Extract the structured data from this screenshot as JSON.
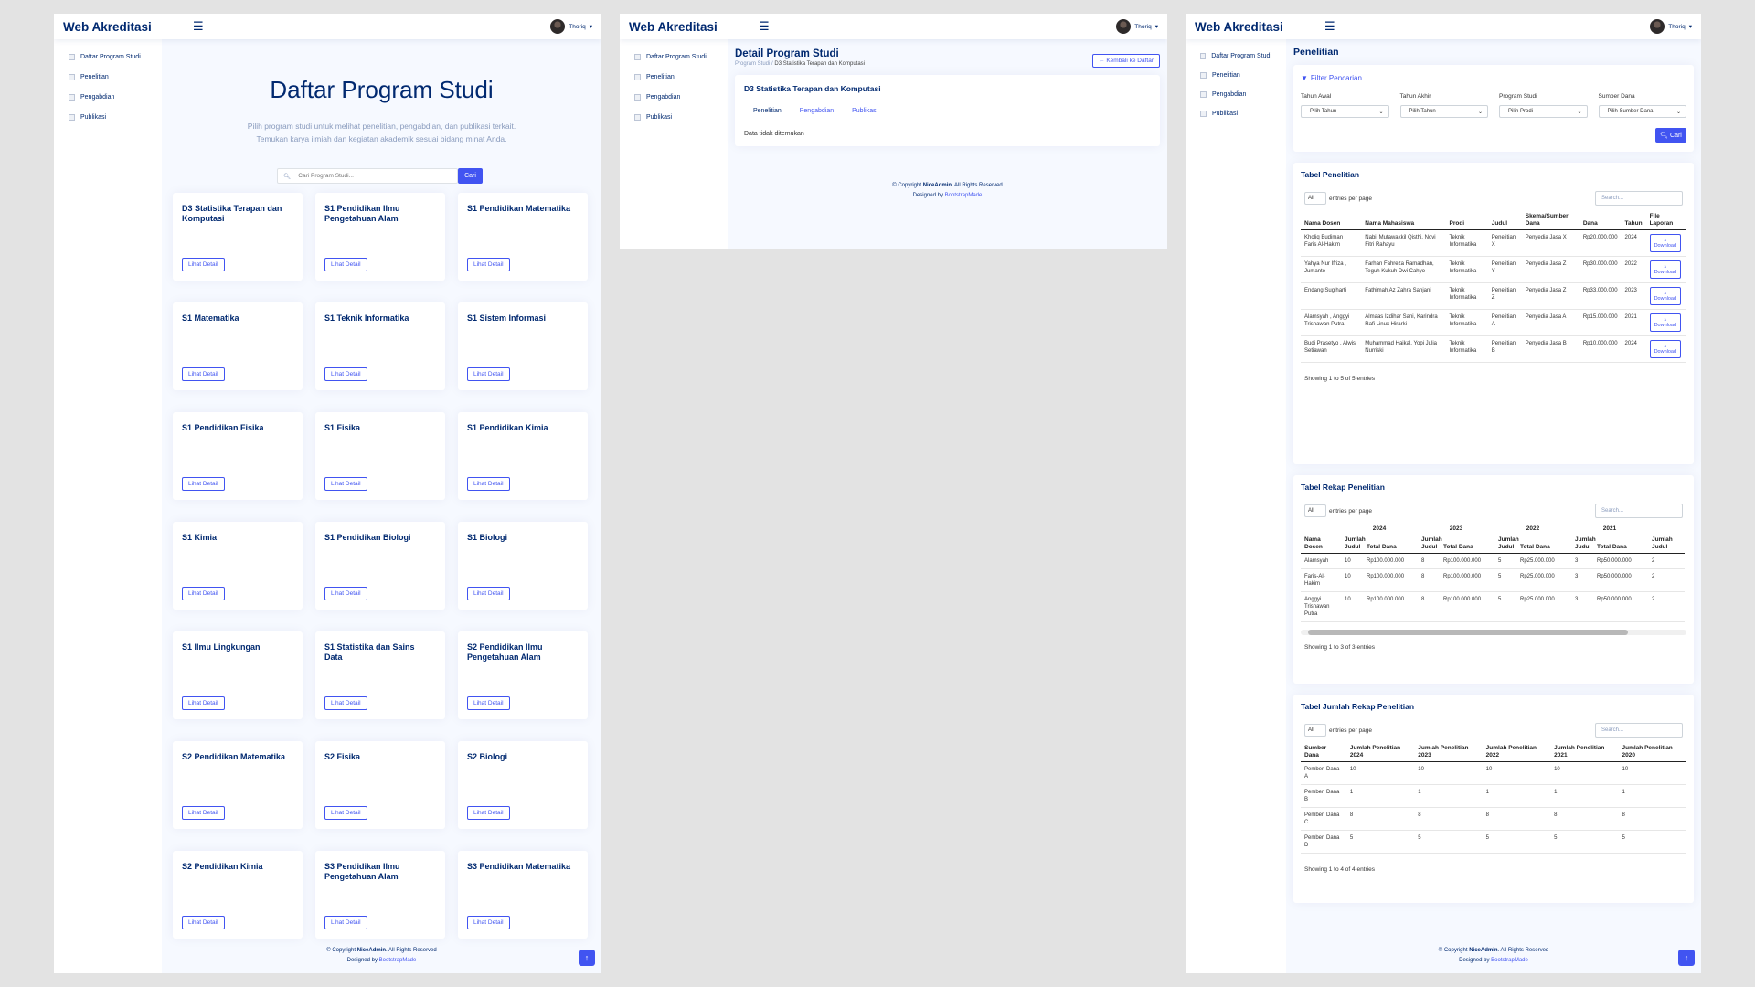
{
  "app": {
    "logo": "Web Akreditasi",
    "user_name": "Thoriq"
  },
  "sidebar": {
    "items": [
      "Daftar Program Studi",
      "Penelitian",
      "Pengabdian",
      "Publikasi"
    ]
  },
  "footer": {
    "copyright_prefix": "© Copyright",
    "brand": "NiceAdmin",
    "rights": ". All Rights Reserved",
    "designed_by": "Designed by",
    "designer": "BootstrapMade"
  },
  "panel1": {
    "title": "Daftar Program Studi",
    "subtitle_line1": "Pilih program studi untuk melihat penelitian, pengabdian, dan publikasi terkait.",
    "subtitle_line2": "Temukan karya ilmiah dan kegiatan akademik sesuai bidang minat Anda.",
    "search_placeholder": "Cari Program Studi...",
    "search_button": "Cari",
    "detail_button": "Lihat Detail",
    "programs": [
      "D3 Statistika Terapan dan Komputasi",
      "S1 Pendidikan Ilmu Pengetahuan Alam",
      "S1 Pendidikan Matematika",
      "S1 Matematika",
      "S1 Teknik Informatika",
      "S1 Sistem Informasi",
      "S1 Pendidikan Fisika",
      "S1 Fisika",
      "S1 Pendidikan Kimia",
      "S1 Kimia",
      "S1 Pendidikan Biologi",
      "S1 Biologi",
      "S1 Ilmu Lingkungan",
      "S1 Statistika dan Sains Data",
      "S2 Pendidikan Ilmu Pengetahuan Alam",
      "S2 Pendidikan Matematika",
      "S2 Fisika",
      "S2 Biologi",
      "S2 Pendidikan Kimia",
      "S3 Pendidikan Ilmu Pengetahuan Alam",
      "S3 Pendidikan Matematika"
    ]
  },
  "panel2": {
    "title": "Detail Program Studi",
    "breadcrumb_root": "Program Studi",
    "breadcrumb_current": "D3 Statistika Terapan dan Komputasi",
    "back_button": "Kembali ke Daftar",
    "program_name": "D3 Statistika Terapan dan Komputasi",
    "tabs": [
      "Penelitian",
      "Pengabdian",
      "Publikasi"
    ],
    "empty_text": "Data tidak ditemukan"
  },
  "panel3": {
    "page_title": "Penelitian",
    "filter_title": "Filter Pencarian",
    "filters": [
      {
        "label": "Tahun Awal",
        "value": "--Pilih Tahun--"
      },
      {
        "label": "Tahun Akhir",
        "value": "--Pilih Tahun--"
      },
      {
        "label": "Program Studi",
        "value": "--Pilih Prodi--"
      },
      {
        "label": "Sumber Dana",
        "value": "--Pilih Sumber Dana--"
      }
    ],
    "search_button": "Cari",
    "entries_value": "All",
    "entries_label": "entries per page",
    "search_placeholder": "Search...",
    "download_label": "Download",
    "table1": {
      "title": "Tabel Penelitian",
      "headers": [
        "Nama Dosen",
        "Nama Mahasiswa",
        "Prodi",
        "Judul",
        "Skema/Sumber Dana",
        "Dana",
        "Tahun",
        "File Laporan"
      ],
      "rows": [
        [
          "Kholiq Budiman , Faris Al-Hakim",
          "Nabil Mutawakkil Qisthi, Novi Fitri Rahayu",
          "Teknik Informatika",
          "Penelitian X",
          "Penyedia Jasa X",
          "Rp20.000.000",
          "2024"
        ],
        [
          "Yahya Nur Ifriza , Jumanto",
          "Farhan Fahreza Ramadhan, Teguh Kukuh Dwi Cahyo",
          "Teknik Informatika",
          "Penelitian Y",
          "Penyedia Jasa Z",
          "Rp30.000.000",
          "2022"
        ],
        [
          "Endang Sugiharti",
          "Fathimah Az Zahra Sanjani",
          "Teknik Informatika",
          "Penelitian Z",
          "Penyedia Jasa Z",
          "Rp33.000.000",
          "2023"
        ],
        [
          "Alamsyah , Anggyi Trisnawan Putra",
          "Almaas Izdihar Sani, Karindra Rafi Linux Hirarki",
          "Teknik Informatika",
          "Penelitian A",
          "Penyedia Jasa A",
          "Rp15.000.000",
          "2021"
        ],
        [
          "Budi Prasetyo , Alwis Setiawan",
          "Muhammad Haikal, Yopi Julia Nurriski",
          "Teknik Informatika",
          "Penelitian B",
          "Penyedia Jasa B",
          "Rp10.000.000",
          "2024"
        ]
      ],
      "showing": "Showing 1 to 5 of 5 entries"
    },
    "table2": {
      "title": "Tabel Rekap Penelitian",
      "years": [
        "2024",
        "2023",
        "2022",
        "2021"
      ],
      "headers": [
        "Nama Dosen",
        "Jumlah Judul",
        "Total Dana",
        "Jumlah Judul",
        "Total Dana",
        "Jumlah Judul",
        "Total Dana",
        "Jumlah Judul",
        "Total Dana",
        "Jumlah Judul"
      ],
      "rows": [
        [
          "Alamsyah",
          "10",
          "Rp100.000.000",
          "8",
          "Rp100.000.000",
          "5",
          "Rp25.000.000",
          "3",
          "Rp50.000.000",
          "2"
        ],
        [
          "Faris-Al-Hakim",
          "10",
          "Rp100.000.000",
          "8",
          "Rp100.000.000",
          "5",
          "Rp25.000.000",
          "3",
          "Rp50.000.000",
          "2"
        ],
        [
          "Anggyi Trisnawan Putra",
          "10",
          "Rp100.000.000",
          "8",
          "Rp100.000.000",
          "5",
          "Rp25.000.000",
          "3",
          "Rp50.000.000",
          "2"
        ]
      ],
      "showing": "Showing 1 to 3 of 3 entries"
    },
    "table3": {
      "title": "Tabel Jumlah Rekap Penelitian",
      "headers": [
        "Sumber Dana",
        "Jumlah Penelitian 2024",
        "Jumlah Penelitian 2023",
        "Jumlah Penelitian 2022",
        "Jumlah Penelitian 2021",
        "Jumlah Penelitian 2020"
      ],
      "rows": [
        [
          "Pemberi Dana A",
          "10",
          "10",
          "10",
          "10",
          "10"
        ],
        [
          "Pemberi Dana B",
          "1",
          "1",
          "1",
          "1",
          "1"
        ],
        [
          "Pemberi Dana C",
          "8",
          "8",
          "8",
          "8",
          "8"
        ],
        [
          "Pemberi Dana D",
          "5",
          "5",
          "5",
          "5",
          "5"
        ]
      ],
      "showing": "Showing 1 to 4 of 4 entries"
    }
  }
}
